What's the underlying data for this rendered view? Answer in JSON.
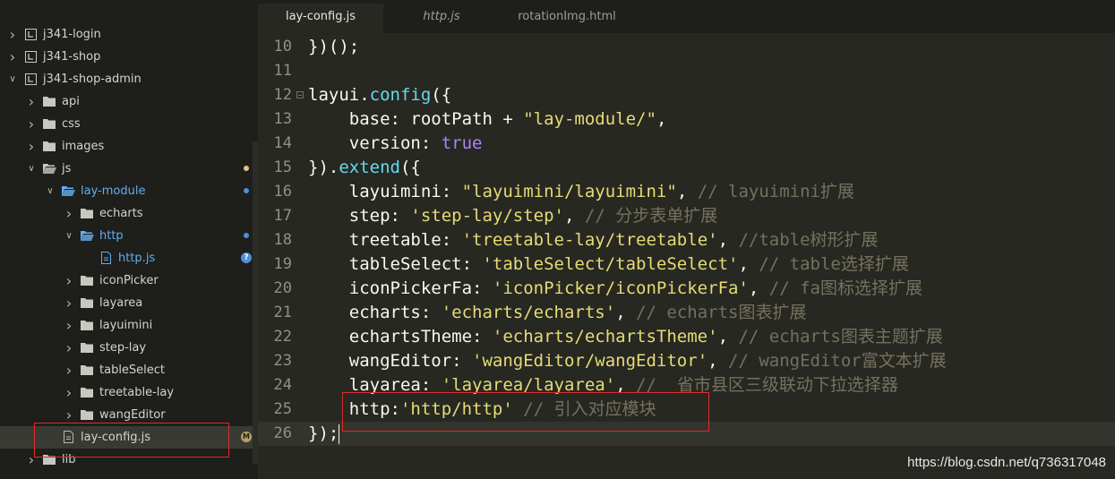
{
  "tabs": [
    {
      "label": "lay-config.js",
      "active": true,
      "italic": false
    },
    {
      "label": "http.js",
      "active": false,
      "italic": true
    },
    {
      "label": "rotationImg.html",
      "active": false,
      "italic": false
    }
  ],
  "tree": [
    {
      "label": "j341-login",
      "depth": 0,
      "expanded": false,
      "icon": "project-icon",
      "color": "default"
    },
    {
      "label": "j341-shop",
      "depth": 0,
      "expanded": false,
      "icon": "project-icon",
      "color": "default"
    },
    {
      "label": "j341-shop-admin",
      "depth": 0,
      "expanded": true,
      "icon": "project-icon",
      "color": "default"
    },
    {
      "label": "api",
      "depth": 1,
      "expanded": false,
      "icon": "folder-icon",
      "color": "default"
    },
    {
      "label": "css",
      "depth": 1,
      "expanded": false,
      "icon": "folder-icon",
      "color": "default"
    },
    {
      "label": "images",
      "depth": 1,
      "expanded": false,
      "icon": "folder-icon",
      "color": "default"
    },
    {
      "label": "js",
      "depth": 1,
      "expanded": true,
      "icon": "folder-open-icon",
      "color": "default",
      "badge": "dot-yellow"
    },
    {
      "label": "lay-module",
      "depth": 2,
      "expanded": true,
      "icon": "folder-open-icon",
      "color": "blue",
      "badge": "dot-blue"
    },
    {
      "label": "echarts",
      "depth": 3,
      "expanded": false,
      "icon": "folder-icon",
      "color": "default"
    },
    {
      "label": "http",
      "depth": 3,
      "expanded": true,
      "icon": "folder-open-icon",
      "color": "blue",
      "badge": "dot-blue"
    },
    {
      "label": "http.js",
      "depth": 4,
      "expanded": null,
      "icon": "file-icon",
      "color": "blue",
      "badge": "question"
    },
    {
      "label": "iconPicker",
      "depth": 3,
      "expanded": false,
      "icon": "folder-icon",
      "color": "default"
    },
    {
      "label": "layarea",
      "depth": 3,
      "expanded": false,
      "icon": "folder-icon",
      "color": "default"
    },
    {
      "label": "layuimini",
      "depth": 3,
      "expanded": false,
      "icon": "folder-icon",
      "color": "default"
    },
    {
      "label": "step-lay",
      "depth": 3,
      "expanded": false,
      "icon": "folder-icon",
      "color": "default"
    },
    {
      "label": "tableSelect",
      "depth": 3,
      "expanded": false,
      "icon": "folder-icon",
      "color": "default"
    },
    {
      "label": "treetable-lay",
      "depth": 3,
      "expanded": false,
      "icon": "folder-icon",
      "color": "default"
    },
    {
      "label": "wangEditor",
      "depth": 3,
      "expanded": false,
      "icon": "folder-icon",
      "color": "default"
    },
    {
      "label": "lay-config.js",
      "depth": 2,
      "expanded": null,
      "icon": "file-icon",
      "color": "default",
      "badge": "modified",
      "selected": true
    },
    {
      "label": "lib",
      "depth": 1,
      "expanded": false,
      "icon": "folder-icon",
      "color": "default"
    }
  ],
  "badges": {
    "modified": "M",
    "question": "?"
  },
  "colors": {
    "background": "#272822",
    "sidebar": "#1e1e1b",
    "string": "#e6db74",
    "function": "#66d9ef",
    "keyword": "#ae81ff",
    "comment": "#75715e",
    "highlight_box": "#e02a2a",
    "blue_item": "#61afef"
  },
  "code": [
    {
      "no": "10",
      "fold": false,
      "tokens": [
        {
          "t": "})();",
          "c": "plain"
        }
      ]
    },
    {
      "no": "11",
      "fold": false,
      "tokens": []
    },
    {
      "no": "12",
      "fold": true,
      "tokens": [
        {
          "t": "layui.",
          "c": "plain"
        },
        {
          "t": "config",
          "c": "fn"
        },
        {
          "t": "({",
          "c": "plain"
        }
      ]
    },
    {
      "no": "13",
      "fold": false,
      "tokens": [
        {
          "t": "    base: rootPath + ",
          "c": "plain"
        },
        {
          "t": "\"lay-module/\"",
          "c": "str"
        },
        {
          "t": ",",
          "c": "plain"
        }
      ]
    },
    {
      "no": "14",
      "fold": false,
      "tokens": [
        {
          "t": "    version: ",
          "c": "plain"
        },
        {
          "t": "true",
          "c": "kw"
        }
      ]
    },
    {
      "no": "15",
      "fold": false,
      "tokens": [
        {
          "t": "}).",
          "c": "plain"
        },
        {
          "t": "extend",
          "c": "fn"
        },
        {
          "t": "({",
          "c": "plain"
        }
      ]
    },
    {
      "no": "16",
      "fold": false,
      "tokens": [
        {
          "t": "    layuimini: ",
          "c": "plain"
        },
        {
          "t": "\"layuimini/layuimini\"",
          "c": "str"
        },
        {
          "t": ", ",
          "c": "plain"
        },
        {
          "t": "// layuimini扩展",
          "c": "com"
        }
      ]
    },
    {
      "no": "17",
      "fold": false,
      "tokens": [
        {
          "t": "    step: ",
          "c": "plain"
        },
        {
          "t": "'step-lay/step'",
          "c": "str"
        },
        {
          "t": ", ",
          "c": "plain"
        },
        {
          "t": "// 分步表单扩展",
          "c": "com"
        }
      ]
    },
    {
      "no": "18",
      "fold": false,
      "tokens": [
        {
          "t": "    treetable: ",
          "c": "plain"
        },
        {
          "t": "'treetable-lay/treetable'",
          "c": "str"
        },
        {
          "t": ", ",
          "c": "plain"
        },
        {
          "t": "//table树形扩展",
          "c": "com"
        }
      ]
    },
    {
      "no": "19",
      "fold": false,
      "tokens": [
        {
          "t": "    tableSelect: ",
          "c": "plain"
        },
        {
          "t": "'tableSelect/tableSelect'",
          "c": "str"
        },
        {
          "t": ", ",
          "c": "plain"
        },
        {
          "t": "// table选择扩展",
          "c": "com"
        }
      ]
    },
    {
      "no": "20",
      "fold": false,
      "tokens": [
        {
          "t": "    iconPickerFa: ",
          "c": "plain"
        },
        {
          "t": "'iconPicker/iconPickerFa'",
          "c": "str"
        },
        {
          "t": ", ",
          "c": "plain"
        },
        {
          "t": "// fa图标选择扩展",
          "c": "com"
        }
      ]
    },
    {
      "no": "21",
      "fold": false,
      "tokens": [
        {
          "t": "    echarts: ",
          "c": "plain"
        },
        {
          "t": "'echarts/echarts'",
          "c": "str"
        },
        {
          "t": ", ",
          "c": "plain"
        },
        {
          "t": "// echarts图表扩展",
          "c": "com"
        }
      ]
    },
    {
      "no": "22",
      "fold": false,
      "tokens": [
        {
          "t": "    echartsTheme: ",
          "c": "plain"
        },
        {
          "t": "'echarts/echartsTheme'",
          "c": "str"
        },
        {
          "t": ", ",
          "c": "plain"
        },
        {
          "t": "// echarts图表主题扩展",
          "c": "com"
        }
      ]
    },
    {
      "no": "23",
      "fold": false,
      "tokens": [
        {
          "t": "    wangEditor: ",
          "c": "plain"
        },
        {
          "t": "'wangEditor/wangEditor'",
          "c": "str"
        },
        {
          "t": ", ",
          "c": "plain"
        },
        {
          "t": "// wangEditor富文本扩展",
          "c": "com"
        }
      ]
    },
    {
      "no": "24",
      "fold": false,
      "tokens": [
        {
          "t": "    layarea: ",
          "c": "plain"
        },
        {
          "t": "'layarea/layarea'",
          "c": "str"
        },
        {
          "t": ", ",
          "c": "plain"
        },
        {
          "t": "//  省市县区三级联动下拉选择器",
          "c": "com"
        }
      ]
    },
    {
      "no": "25",
      "fold": false,
      "tokens": [
        {
          "t": "    http:",
          "c": "plain"
        },
        {
          "t": "'http/http'",
          "c": "str"
        },
        {
          "t": " ",
          "c": "plain"
        },
        {
          "t": "// 引入对应模块",
          "c": "com"
        }
      ]
    },
    {
      "no": "26",
      "fold": false,
      "current": true,
      "tokens": [
        {
          "t": "});",
          "c": "plain"
        }
      ]
    }
  ],
  "watermark": "https://blog.csdn.net/q736317048"
}
